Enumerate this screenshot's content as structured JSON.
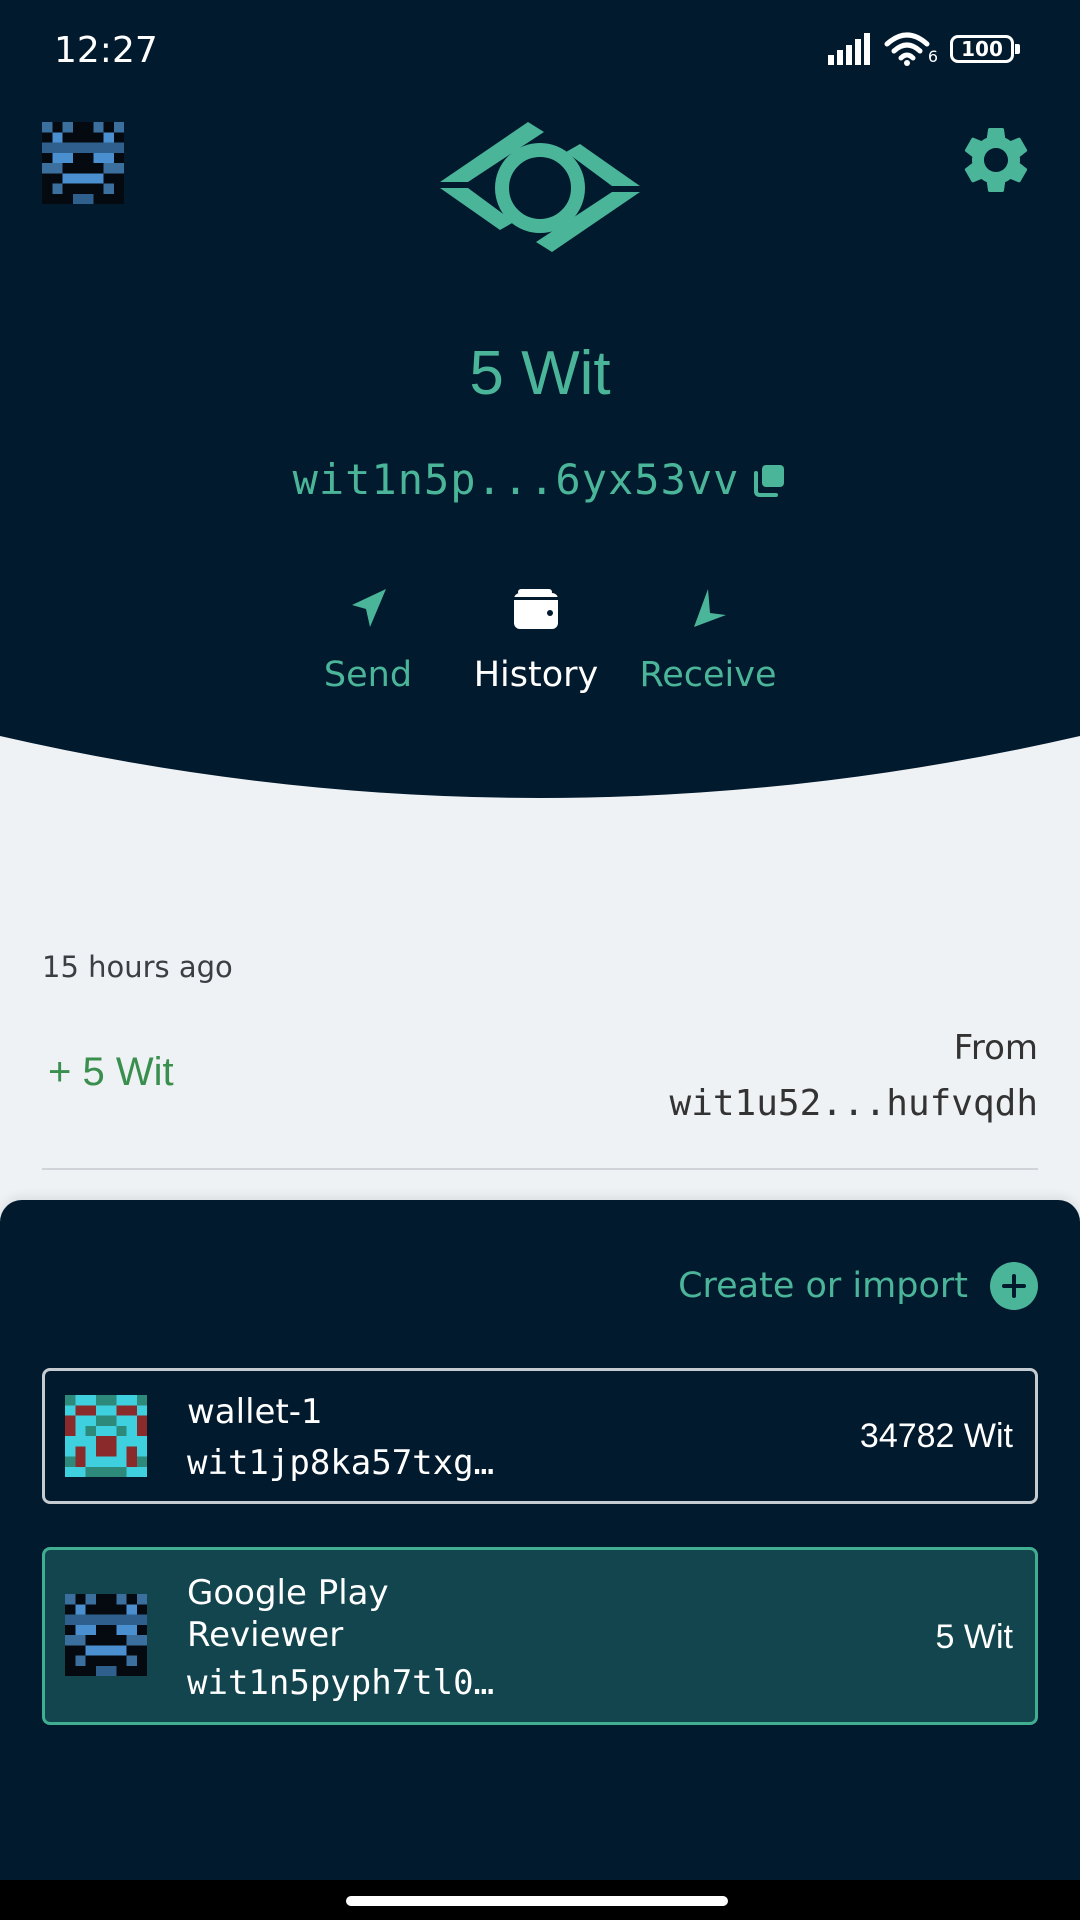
{
  "status_bar": {
    "time": "12:27",
    "battery": "100",
    "wifi_badge": "6"
  },
  "header": {
    "balance": "5 Wit",
    "address": "wit1n5p...6yx53vv",
    "actions": {
      "send": "Send",
      "history": "History",
      "receive": "Receive"
    }
  },
  "transactions": [
    {
      "time": "15 hours ago",
      "amount": "+ 5 Wit",
      "from_label": "From",
      "from_address": "wit1u52...hufvqdh"
    }
  ],
  "wallets_panel": {
    "create_label": "Create or import",
    "wallets": [
      {
        "name": "wallet-1",
        "address": "wit1jp8ka57txg…",
        "balance": "34782 Wit",
        "selected": false
      },
      {
        "name": "Google Play Reviewer",
        "address": "wit1n5pyph7tl0…",
        "balance": "5 Wit",
        "selected": true
      }
    ]
  },
  "colors": {
    "background_dark": "#021a2d",
    "accent": "#4bb59a",
    "positive": "#3a8f4f",
    "selected_card": "#13454f",
    "page_light": "#eff2f5"
  },
  "icons": [
    "signal-icon",
    "wifi-icon",
    "battery-icon",
    "settings-gear-icon",
    "logo-icon",
    "copy-icon",
    "send-icon",
    "wallet-icon",
    "receive-icon",
    "plus-icon"
  ]
}
